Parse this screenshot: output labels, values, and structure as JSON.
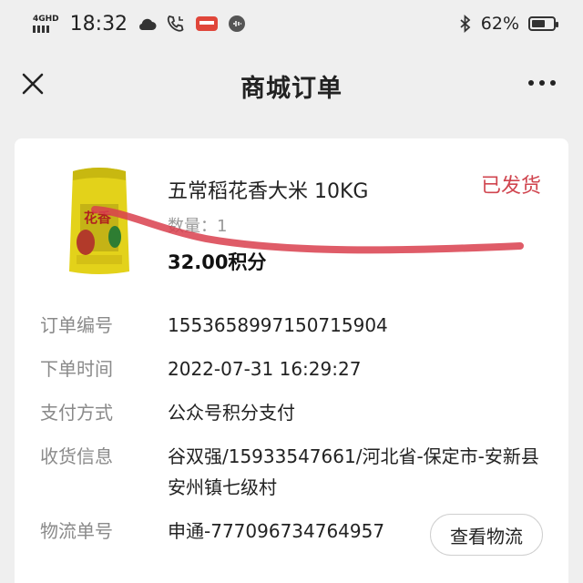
{
  "status_bar": {
    "network": "4GHD",
    "time": "18:32",
    "battery": "62%",
    "battery_level": 0.62
  },
  "nav": {
    "title": "商城订单"
  },
  "order": {
    "product_name": "五常稻花香大米 10KG",
    "status": "已发货",
    "quantity_label": "数量：",
    "quantity": "1",
    "price": "32.00积分",
    "product_image_text": "花香"
  },
  "details": [
    {
      "label": "订单编号",
      "value": "1553658997150715904"
    },
    {
      "label": "下单时间",
      "value": "2022-07-31 16:29:27"
    },
    {
      "label": "支付方式",
      "value": "公众号积分支付"
    },
    {
      "label": "收货信息",
      "value": "谷双强/15933547661/河北省-保定市-安新县安州镇七级村"
    },
    {
      "label": "物流单号",
      "value": "申通-777096734764957"
    }
  ],
  "actions": {
    "track_label": "查看物流"
  },
  "colors": {
    "status_red": "#d0454f",
    "scribble_red": "#d9404d",
    "rice_bag_yellow": "#e3d21a"
  }
}
